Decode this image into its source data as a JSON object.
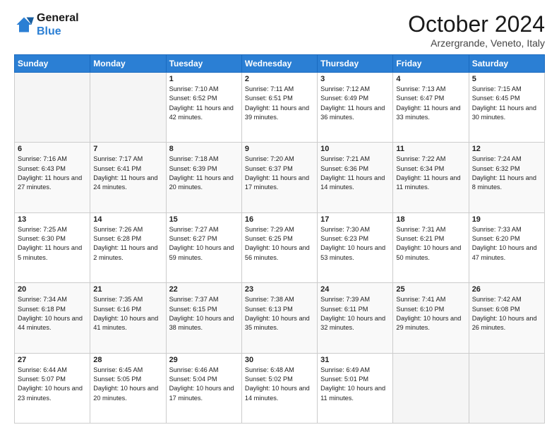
{
  "logo": {
    "line1": "General",
    "line2": "Blue"
  },
  "title": "October 2024",
  "location": "Arzergrande, Veneto, Italy",
  "weekdays": [
    "Sunday",
    "Monday",
    "Tuesday",
    "Wednesday",
    "Thursday",
    "Friday",
    "Saturday"
  ],
  "weeks": [
    [
      {
        "day": "",
        "content": ""
      },
      {
        "day": "",
        "content": ""
      },
      {
        "day": "1",
        "content": "Sunrise: 7:10 AM\nSunset: 6:52 PM\nDaylight: 11 hours and 42 minutes."
      },
      {
        "day": "2",
        "content": "Sunrise: 7:11 AM\nSunset: 6:51 PM\nDaylight: 11 hours and 39 minutes."
      },
      {
        "day": "3",
        "content": "Sunrise: 7:12 AM\nSunset: 6:49 PM\nDaylight: 11 hours and 36 minutes."
      },
      {
        "day": "4",
        "content": "Sunrise: 7:13 AM\nSunset: 6:47 PM\nDaylight: 11 hours and 33 minutes."
      },
      {
        "day": "5",
        "content": "Sunrise: 7:15 AM\nSunset: 6:45 PM\nDaylight: 11 hours and 30 minutes."
      }
    ],
    [
      {
        "day": "6",
        "content": "Sunrise: 7:16 AM\nSunset: 6:43 PM\nDaylight: 11 hours and 27 minutes."
      },
      {
        "day": "7",
        "content": "Sunrise: 7:17 AM\nSunset: 6:41 PM\nDaylight: 11 hours and 24 minutes."
      },
      {
        "day": "8",
        "content": "Sunrise: 7:18 AM\nSunset: 6:39 PM\nDaylight: 11 hours and 20 minutes."
      },
      {
        "day": "9",
        "content": "Sunrise: 7:20 AM\nSunset: 6:37 PM\nDaylight: 11 hours and 17 minutes."
      },
      {
        "day": "10",
        "content": "Sunrise: 7:21 AM\nSunset: 6:36 PM\nDaylight: 11 hours and 14 minutes."
      },
      {
        "day": "11",
        "content": "Sunrise: 7:22 AM\nSunset: 6:34 PM\nDaylight: 11 hours and 11 minutes."
      },
      {
        "day": "12",
        "content": "Sunrise: 7:24 AM\nSunset: 6:32 PM\nDaylight: 11 hours and 8 minutes."
      }
    ],
    [
      {
        "day": "13",
        "content": "Sunrise: 7:25 AM\nSunset: 6:30 PM\nDaylight: 11 hours and 5 minutes."
      },
      {
        "day": "14",
        "content": "Sunrise: 7:26 AM\nSunset: 6:28 PM\nDaylight: 11 hours and 2 minutes."
      },
      {
        "day": "15",
        "content": "Sunrise: 7:27 AM\nSunset: 6:27 PM\nDaylight: 10 hours and 59 minutes."
      },
      {
        "day": "16",
        "content": "Sunrise: 7:29 AM\nSunset: 6:25 PM\nDaylight: 10 hours and 56 minutes."
      },
      {
        "day": "17",
        "content": "Sunrise: 7:30 AM\nSunset: 6:23 PM\nDaylight: 10 hours and 53 minutes."
      },
      {
        "day": "18",
        "content": "Sunrise: 7:31 AM\nSunset: 6:21 PM\nDaylight: 10 hours and 50 minutes."
      },
      {
        "day": "19",
        "content": "Sunrise: 7:33 AM\nSunset: 6:20 PM\nDaylight: 10 hours and 47 minutes."
      }
    ],
    [
      {
        "day": "20",
        "content": "Sunrise: 7:34 AM\nSunset: 6:18 PM\nDaylight: 10 hours and 44 minutes."
      },
      {
        "day": "21",
        "content": "Sunrise: 7:35 AM\nSunset: 6:16 PM\nDaylight: 10 hours and 41 minutes."
      },
      {
        "day": "22",
        "content": "Sunrise: 7:37 AM\nSunset: 6:15 PM\nDaylight: 10 hours and 38 minutes."
      },
      {
        "day": "23",
        "content": "Sunrise: 7:38 AM\nSunset: 6:13 PM\nDaylight: 10 hours and 35 minutes."
      },
      {
        "day": "24",
        "content": "Sunrise: 7:39 AM\nSunset: 6:11 PM\nDaylight: 10 hours and 32 minutes."
      },
      {
        "day": "25",
        "content": "Sunrise: 7:41 AM\nSunset: 6:10 PM\nDaylight: 10 hours and 29 minutes."
      },
      {
        "day": "26",
        "content": "Sunrise: 7:42 AM\nSunset: 6:08 PM\nDaylight: 10 hours and 26 minutes."
      }
    ],
    [
      {
        "day": "27",
        "content": "Sunrise: 6:44 AM\nSunset: 5:07 PM\nDaylight: 10 hours and 23 minutes."
      },
      {
        "day": "28",
        "content": "Sunrise: 6:45 AM\nSunset: 5:05 PM\nDaylight: 10 hours and 20 minutes."
      },
      {
        "day": "29",
        "content": "Sunrise: 6:46 AM\nSunset: 5:04 PM\nDaylight: 10 hours and 17 minutes."
      },
      {
        "day": "30",
        "content": "Sunrise: 6:48 AM\nSunset: 5:02 PM\nDaylight: 10 hours and 14 minutes."
      },
      {
        "day": "31",
        "content": "Sunrise: 6:49 AM\nSunset: 5:01 PM\nDaylight: 10 hours and 11 minutes."
      },
      {
        "day": "",
        "content": ""
      },
      {
        "day": "",
        "content": ""
      }
    ]
  ]
}
